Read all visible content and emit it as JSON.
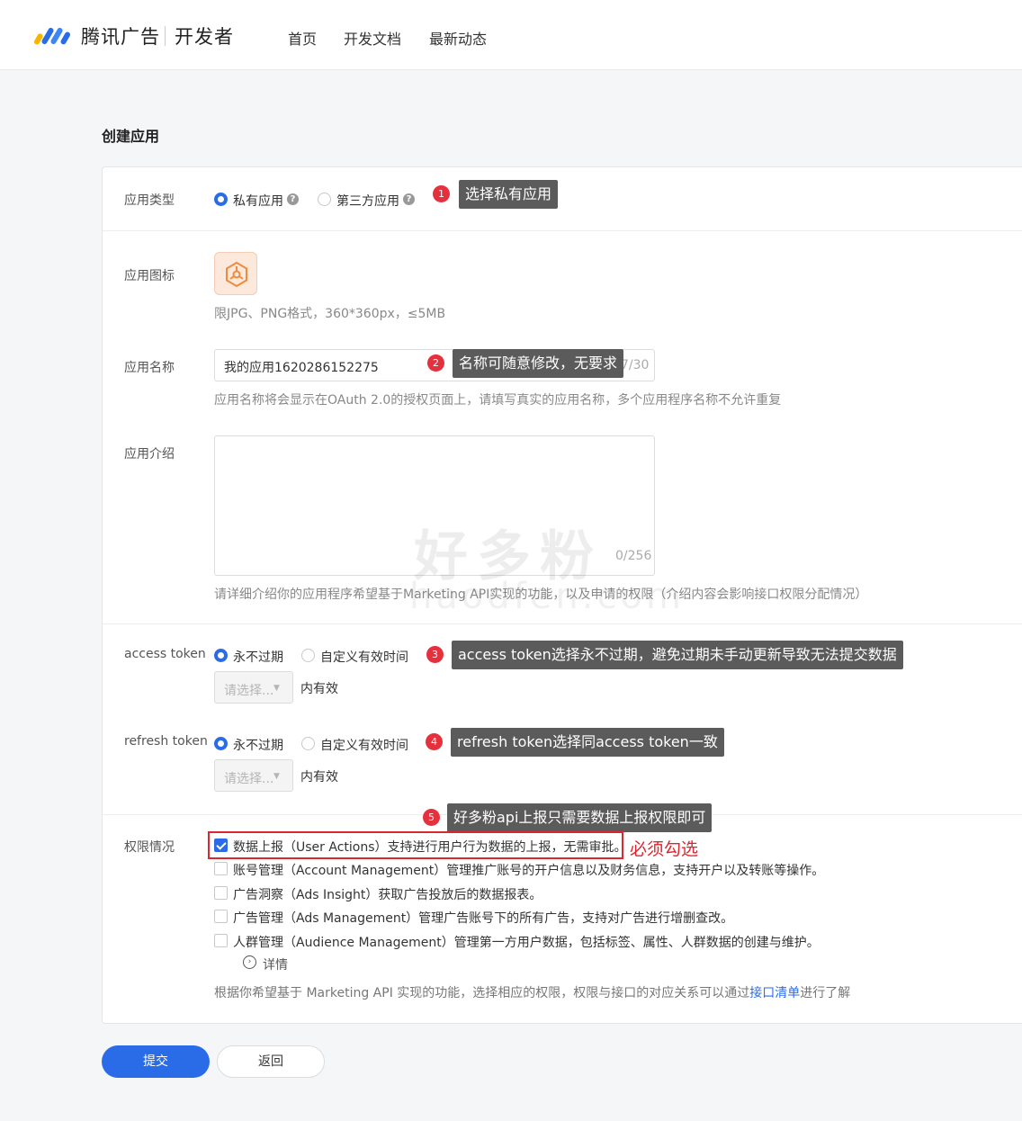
{
  "header": {
    "brand": "腾讯广告",
    "sub": "开发者",
    "nav": [
      "首页",
      "开发文档",
      "最新动态"
    ]
  },
  "page_title": "创建应用",
  "app_type": {
    "label": "应用类型",
    "options": [
      "私有应用",
      "第三方应用"
    ],
    "selected": "私有应用"
  },
  "app_icon": {
    "label": "应用图标",
    "hint": "限JPG、PNG格式，360*360px，≤5MB"
  },
  "app_name": {
    "label": "应用名称",
    "value": "我的应用1620286152275",
    "counter": "7/30",
    "hint": "应用名称将会显示在OAuth 2.0的授权页面上，请填写真实的应用名称，多个应用程序名称不允许重复"
  },
  "app_intro": {
    "label": "应用介绍",
    "counter": "0/256",
    "hint": "请详细介绍你的应用程序希望基于Marketing API实现的功能，以及申请的权限（介绍内容会影响接口权限分配情况）"
  },
  "access_token": {
    "label": "access token",
    "options": [
      "永不过期",
      "自定义有效时间"
    ],
    "selected": "永不过期",
    "select_placeholder": "请选择...",
    "unit": "内有效"
  },
  "refresh_token": {
    "label": "refresh token",
    "options": [
      "永不过期",
      "自定义有效时间"
    ],
    "selected": "永不过期",
    "select_placeholder": "请选择...",
    "unit": "内有效"
  },
  "permissions": {
    "label": "权限情况",
    "items": [
      {
        "text": "数据上报（User Actions）支持进行用户行为数据的上报，无需审批。",
        "checked": true
      },
      {
        "text": "账号管理（Account Management）管理推广账号的开户信息以及财务信息，支持开户以及转账等操作。",
        "checked": false
      },
      {
        "text": "广告洞察（Ads Insight）获取广告投放后的数据报表。",
        "checked": false
      },
      {
        "text": "广告管理（Ads Management）管理广告账号下的所有广告，支持对广告进行增删查改。",
        "checked": false
      },
      {
        "text": "人群管理（Audience Management）管理第一方用户数据，包括标签、属性、人群数据的创建与维护。",
        "checked": false
      }
    ],
    "detail": "详情",
    "footer_prefix": "根据你希望基于 Marketing API 实现的功能，选择相应的权限，权限与接口的对应关系可以通过",
    "footer_link": "接口清单",
    "footer_suffix": "进行了解"
  },
  "annotations": {
    "tips": [
      {
        "num": "1",
        "text": "选择私有应用"
      },
      {
        "num": "2",
        "text": "名称可随意修改，无要求"
      },
      {
        "num": "3",
        "text": "access token选择永不过期，避免过期未手动更新导致无法提交数据"
      },
      {
        "num": "4",
        "text": "refresh token选择同access token一致"
      },
      {
        "num": "5",
        "text": "好多粉api上报只需要数据上报权限即可"
      }
    ],
    "must": "必须勾选"
  },
  "watermark": {
    "main": "好多粉",
    "sub": "haodfen.com"
  },
  "buttons": {
    "submit": "提交",
    "back": "返回"
  },
  "colors": {
    "accent": "#2a6ce8",
    "annotation_red": "#e5303d",
    "tip_bg": "#5b5b5b"
  }
}
